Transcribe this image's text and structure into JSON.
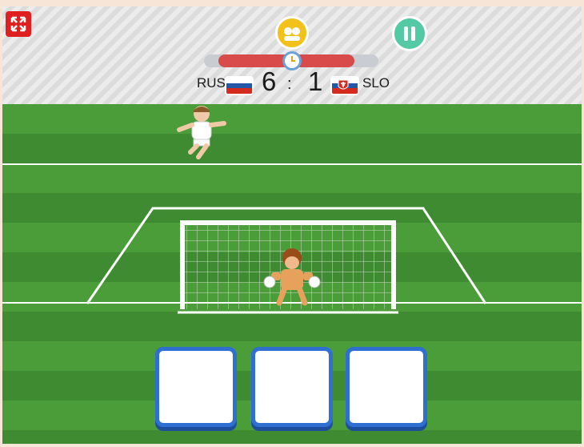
{
  "header": {
    "home_team": "RUS",
    "away_team": "SLO",
    "home_score": "6",
    "away_score": "1",
    "separator": ":",
    "time_remaining_fraction": 0.85
  },
  "icons": {
    "fullscreen": "fullscreen-icon",
    "coin": "coin-icon",
    "pause": "pause-icon",
    "timer": "stopwatch-icon"
  },
  "flags": {
    "home": [
      "#ffffff",
      "#2456a8",
      "#d52b1e"
    ],
    "away": [
      "#ffffff",
      "#2456a8",
      "#d52b1e"
    ]
  },
  "answers": [
    "",
    "",
    ""
  ],
  "colors": {
    "fullscreen": "#e02020",
    "pause": "#53c9a4",
    "coin": "#f2c21a",
    "timer_fill": "#d94a4a",
    "answer_border": "#2f6fd1"
  }
}
